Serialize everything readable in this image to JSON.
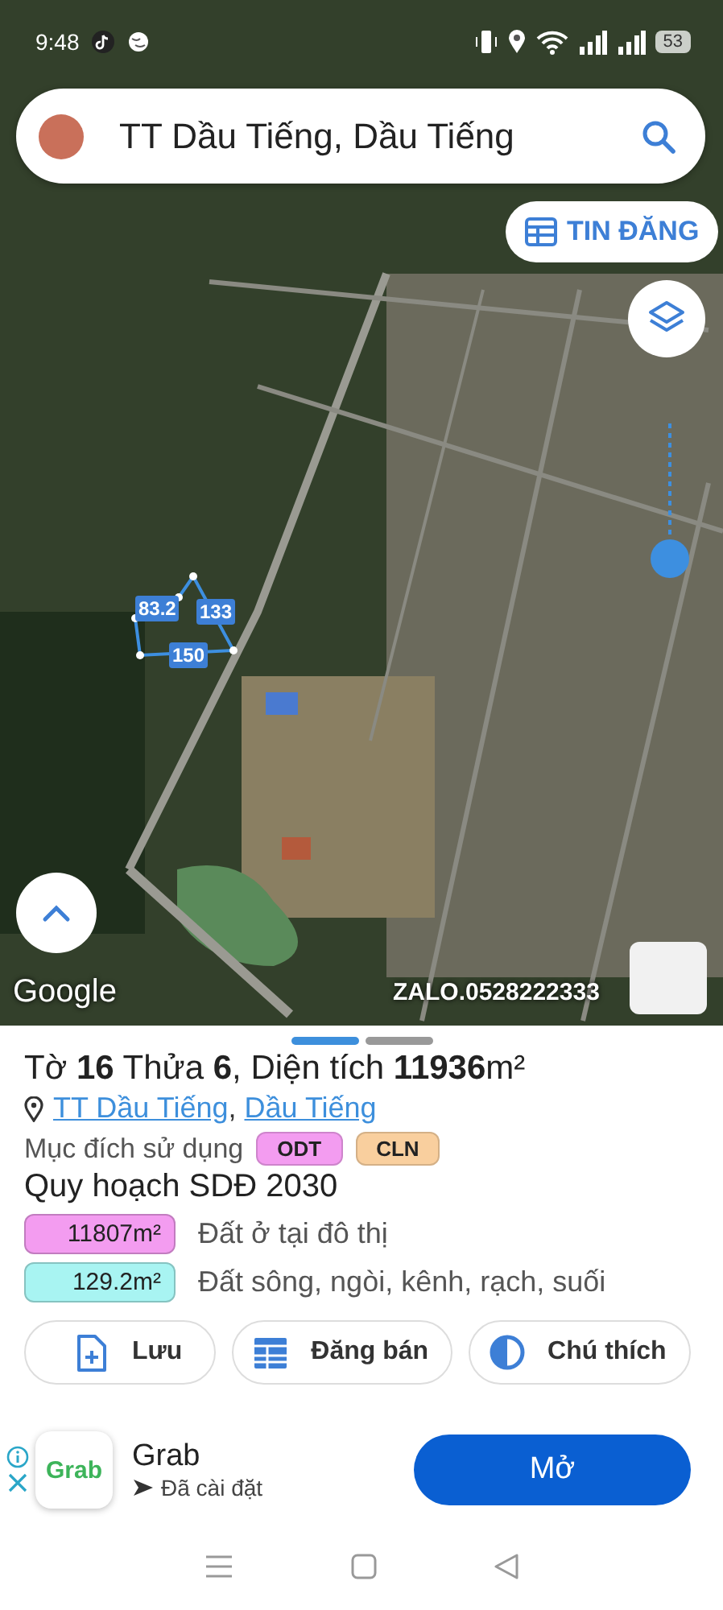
{
  "status_bar": {
    "time": "9:48",
    "battery": "53"
  },
  "search": {
    "value": "TT Dầu Tiếng, Dầu Tiếng"
  },
  "listings_button": {
    "label": "TIN ĐĂNG"
  },
  "parcel": {
    "edges": [
      "83.2",
      "133",
      "150"
    ]
  },
  "map": {
    "attribution": "Google",
    "overlay_text": "ZALO.0528222333"
  },
  "sheet": {
    "pages": [
      {
        "selected": true
      },
      {
        "selected": false
      }
    ],
    "title": "Tờ **16** Thửa **6**, Diện tích **11936**m²",
    "address": {
      "parts": [
        "TT Dầu Tiếng",
        "Dầu Tiếng"
      ],
      "separator": ","
    },
    "usage": {
      "label": "Mục đích sử dụng",
      "tags": [
        {
          "text": "ODT",
          "color": "#f39cf0"
        },
        {
          "text": "CLN",
          "color": "#f9cf9e"
        }
      ]
    },
    "plan": {
      "title": "Quy hoạch SDĐ 2030",
      "rows": [
        {
          "area": "11807m²",
          "label": "Đất ở tại đô thị",
          "color": "#f39cf0"
        },
        {
          "area": "129.2m²",
          "label": "Đất sông, ngòi, kênh, rạch, suối",
          "color": "#a8f4f2"
        }
      ]
    },
    "actions": [
      {
        "kind": "save",
        "label": "Lưu"
      },
      {
        "kind": "post",
        "label": "Đăng bán"
      },
      {
        "kind": "legend",
        "label": "Chú thích"
      }
    ]
  },
  "ad": {
    "logo": "Grab",
    "app": "Grab",
    "status": "Đã cài đặt",
    "button": "Mở"
  }
}
